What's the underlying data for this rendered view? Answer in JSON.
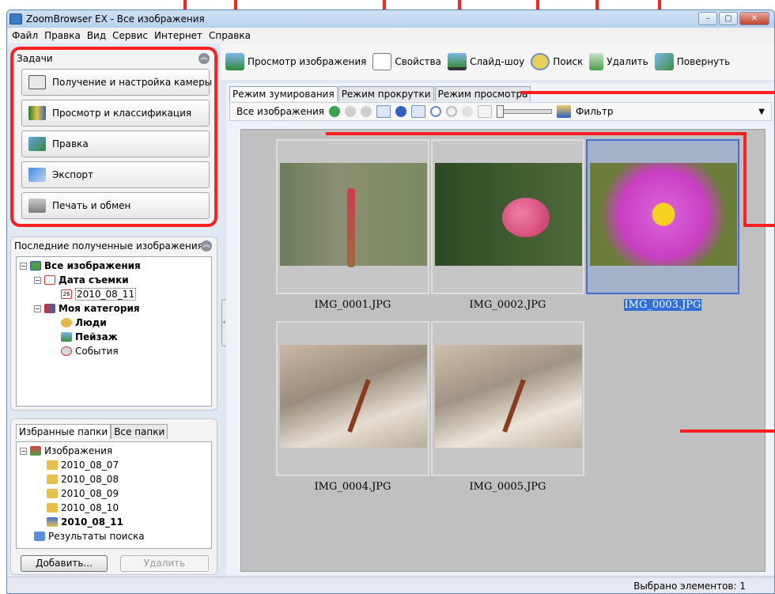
{
  "window": {
    "title": "ZoomBrowser EX  -  Все изображения",
    "controls": [
      "–",
      "▢",
      "✕"
    ]
  },
  "menu": [
    "Файл",
    "Правка",
    "Вид",
    "Сервис",
    "Интернет",
    "Справка"
  ],
  "tasks": {
    "header": "Задачи",
    "buttons": [
      {
        "label": "Получение и настройка камеры",
        "icon": "camera-icon"
      },
      {
        "label": "Просмотр и классификация",
        "icon": "book-icon"
      },
      {
        "label": "Правка",
        "icon": "edit-image-icon"
      },
      {
        "label": "Экспорт",
        "icon": "export-icon"
      },
      {
        "label": "Печать и обмен",
        "icon": "printer-icon"
      }
    ]
  },
  "recent": {
    "title": "Последние полученные изображения",
    "tree": [
      {
        "label": "Все изображения",
        "bold": true,
        "icon": "all-images-icon"
      },
      {
        "label": "Дата съемки",
        "bold": true,
        "icon": "calendar-icon"
      },
      {
        "label": "2010_08_11",
        "bold": false,
        "icon": "calendar-day-icon",
        "day": "26"
      },
      {
        "label": "Моя категория",
        "bold": true,
        "icon": "category-icon"
      },
      {
        "label": "Люди",
        "bold": true,
        "icon": "people-icon"
      },
      {
        "label": "Пейзаж",
        "bold": true,
        "icon": "landscape-icon"
      },
      {
        "label": "События",
        "bold": false,
        "icon": "events-icon"
      }
    ]
  },
  "favorites": {
    "tabs": [
      "Избранные папки",
      "Все папки"
    ],
    "tree": [
      {
        "label": "Изображения",
        "bold": false,
        "icon": "pictures-folder-icon"
      },
      {
        "label": "2010_08_07",
        "bold": false,
        "icon": "folder-icon"
      },
      {
        "label": "2010_08_08",
        "bold": false,
        "icon": "folder-icon"
      },
      {
        "label": "2010_08_09",
        "bold": false,
        "icon": "folder-icon"
      },
      {
        "label": "2010_08_10",
        "bold": false,
        "icon": "folder-icon"
      },
      {
        "label": "2010_08_11",
        "bold": true,
        "icon": "folder-icon"
      },
      {
        "label": "Результаты поиска",
        "bold": false,
        "icon": "search-results-icon"
      }
    ],
    "add_button": "Добавить...",
    "delete_button": "Удалить"
  },
  "toolbar": [
    {
      "label": "Просмотр изображения",
      "icon": "view-image-icon"
    },
    {
      "label": "Свойства",
      "icon": "properties-icon"
    },
    {
      "label": "Слайд-шоу",
      "icon": "slideshow-icon"
    },
    {
      "label": "Поиск",
      "icon": "search-icon"
    },
    {
      "label": "Удалить",
      "icon": "recycle-bin-icon"
    },
    {
      "label": "Повернуть",
      "icon": "rotate-icon"
    }
  ],
  "view_tabs": [
    "Режим зумирования",
    "Режим прокрутки",
    "Режим просмотра"
  ],
  "filter_bar": {
    "location": "Все изображения",
    "filter_label": "Фильтр"
  },
  "thumbnails": [
    {
      "name": "IMG_0001.JPG",
      "selected": false
    },
    {
      "name": "IMG_0002.JPG",
      "selected": false
    },
    {
      "name": "IMG_0003.JPG",
      "selected": true
    },
    {
      "name": "IMG_0004.JPG",
      "selected": false
    },
    {
      "name": "IMG_0005.JPG",
      "selected": false
    }
  ],
  "status": {
    "selected_count": "Выбрано элементов: 1"
  },
  "colors": {
    "highlight": "#ff2020",
    "selection": "#3070d8"
  }
}
